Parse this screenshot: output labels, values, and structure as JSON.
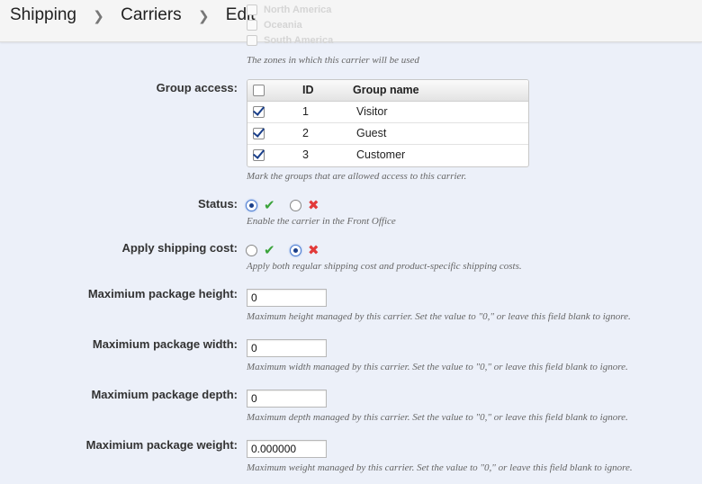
{
  "breadcrumb": {
    "items": [
      "Shipping",
      "Carriers",
      "Edit"
    ]
  },
  "zones": {
    "visible_items": [
      "North America",
      "Oceania",
      "South America"
    ],
    "help": "The zones in which this carrier will be used"
  },
  "group_access": {
    "label": "Group access:",
    "columns": {
      "id": "ID",
      "name": "Group name"
    },
    "rows": [
      {
        "id": "1",
        "name": "Visitor",
        "checked": true
      },
      {
        "id": "2",
        "name": "Guest",
        "checked": true
      },
      {
        "id": "3",
        "name": "Customer",
        "checked": true
      }
    ],
    "help": "Mark the groups that are allowed access to this carrier."
  },
  "status": {
    "label": "Status:",
    "selected": "yes",
    "help": "Enable the carrier in the Front Office"
  },
  "apply_shipping_cost": {
    "label": "Apply shipping cost:",
    "selected": "no",
    "help": "Apply both regular shipping cost and product-specific shipping costs."
  },
  "max_height": {
    "label": "Maximium package height:",
    "value": "0",
    "help": "Maximum height managed by this carrier. Set the value to \"0,\" or leave this field blank to ignore."
  },
  "max_width": {
    "label": "Maximium package width:",
    "value": "0",
    "help": "Maximum width managed by this carrier. Set the value to \"0,\" or leave this field blank to ignore."
  },
  "max_depth": {
    "label": "Maximium package depth:",
    "value": "0",
    "help": "Maximum depth managed by this carrier. Set the value to \"0,\" or leave this field blank to ignore."
  },
  "max_weight": {
    "label": "Maximium package weight:",
    "value": "0.000000",
    "help": "Maximum weight managed by this carrier. Set the value to \"0,\" or leave this field blank to ignore."
  },
  "colors": {
    "accent_yes": "#3aa33a",
    "accent_no": "#e23a3a",
    "check": "#1a3f8a",
    "background": "#ecf0f9"
  }
}
